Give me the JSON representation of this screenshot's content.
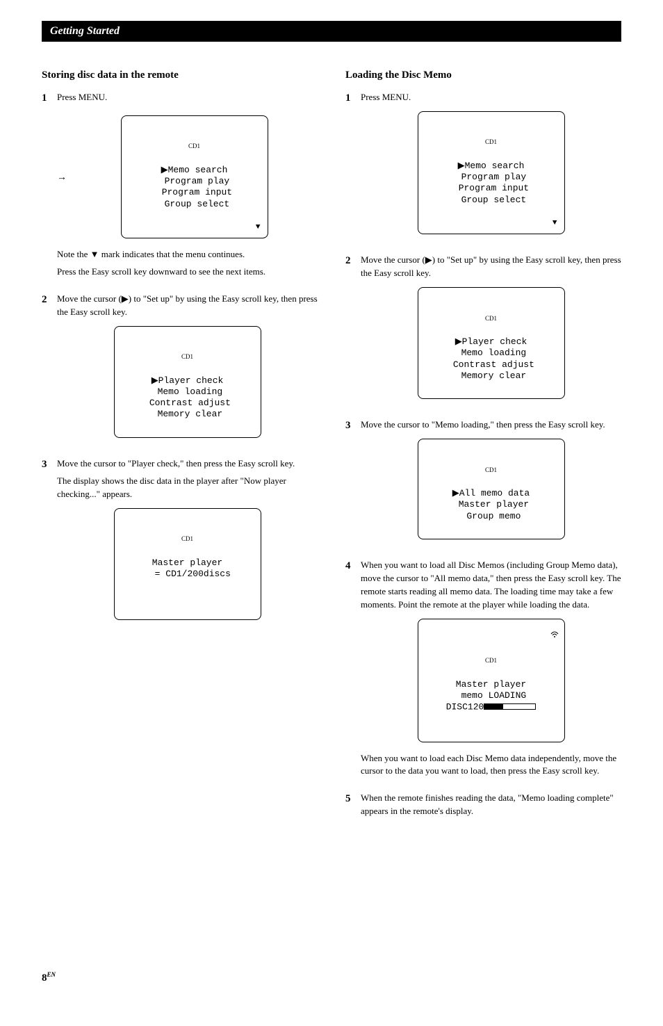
{
  "header": "Getting Started",
  "pageNumber": "8",
  "pageNumberSuffix": "EN",
  "left": {
    "title": "Storing disc data in the remote",
    "step1": {
      "num": "1",
      "text": "Press MENU.",
      "lcd": {
        "header": "CD1",
        "line1": "▶Memo search",
        "line2": " Program play",
        "line3": " Program input",
        "line4": " Group select",
        "hasDown": true
      },
      "note1": "Note the ▼ mark indicates that the menu continues.",
      "note2": "Press the Easy scroll key downward to see the next items."
    },
    "step2": {
      "num": "2",
      "text": "Move the cursor (▶) to \"Set up\" by using the Easy scroll key, then press the Easy scroll key.",
      "lcd": {
        "header": "CD1",
        "line1": "▶Player check",
        "line2": " Memo loading",
        "line3": " Contrast adjust",
        "line4": " Memory clear"
      }
    },
    "step3": {
      "num": "3",
      "text1": "Move the cursor to \"Player check,\" then press the Easy scroll key.",
      "text2": "The display shows the disc data in the player after \"Now player checking...\" appears.",
      "lcd": {
        "header": "CD1",
        "line1": "Master player",
        "line2": "  = CD1/200discs"
      }
    }
  },
  "right": {
    "title": "Loading the Disc Memo",
    "step1": {
      "num": "1",
      "text": "Press MENU.",
      "lcd": {
        "header": "CD1",
        "line1": "▶Memo search",
        "line2": " Program play",
        "line3": " Program input",
        "line4": " Group select",
        "hasDown": true
      }
    },
    "step2": {
      "num": "2",
      "text": "Move the cursor (▶) to \"Set up\" by using the Easy scroll key, then press the Easy scroll key.",
      "lcd": {
        "header": "CD1",
        "line1": "▶Player check",
        "line2": " Memo loading",
        "line3": " Contrast adjust",
        "line4": " Memory clear"
      }
    },
    "step3": {
      "num": "3",
      "text": "Move the cursor to \"Memo loading,\" then press the Easy scroll key.",
      "lcd": {
        "header": "CD1",
        "line1": "▶All memo data",
        "line2": " Master player",
        "line3": " Group memo"
      }
    },
    "step4": {
      "num": "4",
      "text": "When you want to load all Disc Memos (including Group Memo data), move the cursor to \"All memo data,\" then press the Easy scroll key. The remote starts reading all memo data. The loading time may take a few moments. Point the remote at the player while loading the data.",
      "lcd": {
        "header": "CD1",
        "line1": "Master player",
        "line2": " memo LOADING",
        "line3prefix": "DISC120"
      },
      "after": "When you want to load each Disc Memo data independently, move the cursor to the data you want to load, then press the Easy scroll key."
    },
    "step5": {
      "num": "5",
      "text": "When the remote finishes reading the data, \"Memo loading complete\" appears in the remote's display."
    }
  }
}
